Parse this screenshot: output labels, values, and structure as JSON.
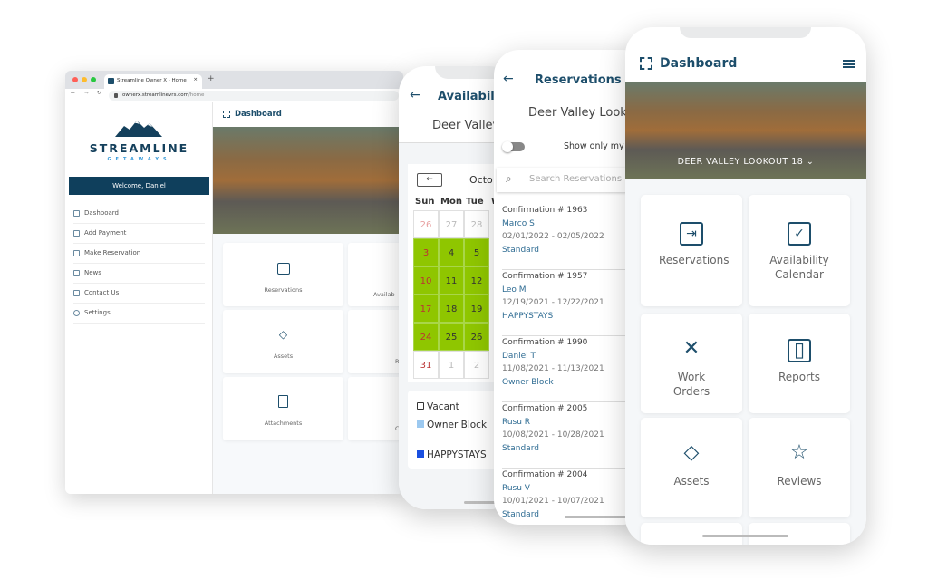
{
  "browser": {
    "tab_title": "Streamline Owner X - Home",
    "url_domain": "ownerx.streamlinevrs.com",
    "url_path": "/home",
    "logo": {
      "name": "STREAMLINE",
      "tagline": "GETAWAYS"
    },
    "welcome": "Welcome, Daniel",
    "nav": [
      {
        "label": "Dashboard",
        "icon": "grid-icon"
      },
      {
        "label": "Add Payment",
        "icon": "payment-icon"
      },
      {
        "label": "Make Reservation",
        "icon": "calendar-check-icon"
      },
      {
        "label": "News",
        "icon": "newspaper-icon"
      },
      {
        "label": "Contact Us",
        "icon": "envelope-icon"
      },
      {
        "label": "Settings",
        "icon": "gear-icon"
      }
    ],
    "page_title": "Dashboard",
    "tiles": [
      "Reservations",
      "Availab",
      "Assets",
      "R",
      "Attachments",
      "C"
    ]
  },
  "availability_phone": {
    "title": "Availabili",
    "property": "Deer Valley",
    "month": "Octo",
    "weekdays": [
      "Sun",
      "Mon",
      "Tue",
      "W"
    ],
    "rows": [
      [
        "26",
        "27",
        "28"
      ],
      [
        "3",
        "4",
        "5"
      ],
      [
        "10",
        "11",
        "12"
      ],
      [
        "17",
        "18",
        "19"
      ],
      [
        "24",
        "25",
        "26"
      ],
      [
        "31",
        "1",
        "2"
      ]
    ],
    "legend": [
      "Vacant",
      "Owner Block",
      "HAPPYSTAYS"
    ],
    "colors": {
      "booked": "#8fc600",
      "owner_block": "#9cc9f0",
      "happystays": "#1a4fe0"
    }
  },
  "reservations_phone": {
    "title": "Reservations",
    "property": "Deer Valley Look",
    "toggle_label": "Show only my",
    "search_placeholder": "Search Reservations",
    "items": [
      {
        "conf": "Confirmation # 1963",
        "name": "Marco S",
        "dates": "02/01/2022 - 02/05/2022",
        "type": "Standard"
      },
      {
        "conf": "Confirmation # 1957",
        "name": "Leo M",
        "dates": "12/19/2021 - 12/22/2021",
        "type": "HAPPYSTAYS"
      },
      {
        "conf": "Confirmation # 1990",
        "name": "Daniel T",
        "dates": "11/08/2021 - 11/13/2021",
        "type": "Owner Block"
      },
      {
        "conf": "Confirmation # 2005",
        "name": "Rusu R",
        "dates": "10/08/2021 - 10/28/2021",
        "type": "Standard"
      },
      {
        "conf": "Confirmation # 2004",
        "name": "Rusu V",
        "dates": "10/01/2021 - 10/07/2021",
        "type": "Standard"
      }
    ]
  },
  "dashboard_phone": {
    "title": "Dashboard",
    "property": "DEER VALLEY LOOKOUT 18",
    "tiles": [
      {
        "label": "Reservations",
        "icon": "calendar-arrow-icon"
      },
      {
        "label": "Availability Calendar",
        "icon": "calendar-check-icon"
      },
      {
        "label": "Work Orders",
        "icon": "tools-icon"
      },
      {
        "label": "Reports",
        "icon": "clipboard-icon"
      },
      {
        "label": "Assets",
        "icon": "diamond-icon"
      },
      {
        "label": "Reviews",
        "icon": "star-icon"
      }
    ]
  }
}
